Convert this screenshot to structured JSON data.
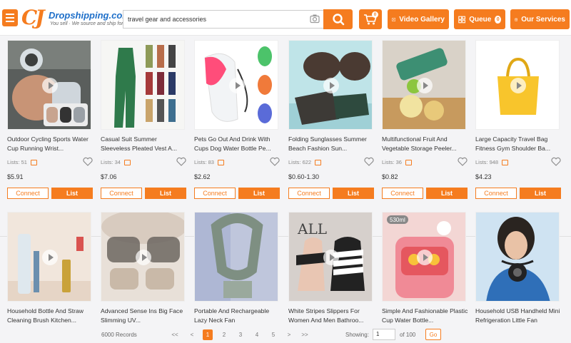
{
  "header": {
    "logo_mark": "CJ",
    "logo_text": "Dropshipping.com",
    "logo_tagline": "You sell · We source and ship for you!",
    "search_value": "travel gear and accessories",
    "cart_count": "0",
    "video_gallery_label": "Video Gallery",
    "queue_label": "Queue",
    "queue_count": "0",
    "services_label": "Our Services",
    "accent_color": "#f57c1f"
  },
  "card_actions": {
    "connect_label": "Connect",
    "list_label": "List"
  },
  "products_row1": [
    {
      "title": "Outdoor Cycling Sports Water Cup Running Wrist...",
      "lists": "Lists: 51",
      "price": "$5.91"
    },
    {
      "title": "Casual Suit Summer Sleeveless Pleated Vest A...",
      "lists": "Lists: 34",
      "price": "$7.06"
    },
    {
      "title": "Pets Go Out And Drink With Cups Dog Water Bottle Pe...",
      "lists": "Lists: 83",
      "price": "$2.62"
    },
    {
      "title": "Folding Sunglasses Summer Beach Fashion Sun...",
      "lists": "Lists: 622",
      "price": "$0.60-1.30"
    },
    {
      "title": "Multifunctional Fruit And Vegetable Storage Peeler...",
      "lists": "Lists: 36",
      "price": "$0.82"
    },
    {
      "title": "Large Capacity Travel Bag Fitness Gym Shoulder Ba...",
      "lists": "Lists: 948",
      "price": "$4.23"
    }
  ],
  "products_row2": [
    {
      "title": "Household Bottle And Straw Cleaning Brush Kitchen..."
    },
    {
      "title": "Advanced Sense Ins Big Face Slimming UV..."
    },
    {
      "title": "Portable And Rechargeable Lazy Neck Fan"
    },
    {
      "title": "White Stripes Slippers For Women And Men Bathroo..."
    },
    {
      "title": "Simple And Fashionable Plastic Cup Water Bottle..."
    },
    {
      "title": "Household USB Handheld Mini Refrigeration Little Fan"
    }
  ],
  "thumb_texts": {
    "sandals_letters": "ALL",
    "bottle_volume": "530ml"
  },
  "pagination": {
    "records": "6000 Records",
    "first": "<<",
    "prev": "<",
    "pages": [
      "1",
      "2",
      "3",
      "4",
      "5"
    ],
    "next": ">",
    "last": ">>",
    "showing_label": "Showing:",
    "page_value": "1",
    "of_total": "of 100",
    "go_label": "Go"
  }
}
